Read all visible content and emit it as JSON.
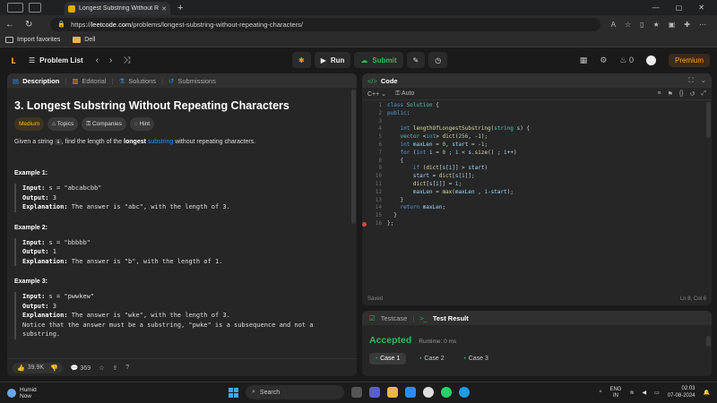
{
  "browser": {
    "tab_title": "Longest Substring Without Repea",
    "url_prefix": "https://",
    "url_host": "leetcode.com",
    "url_path": "/problems/longest-substring-without-repeating-characters/",
    "favorites": [
      "Import favorites",
      "Dell"
    ]
  },
  "nav": {
    "problem_list": "Problem List",
    "run": "Run",
    "submit": "Submit",
    "streak": "0",
    "premium": "Premium"
  },
  "left_tabs": [
    "Description",
    "Editorial",
    "Solutions",
    "Submissions"
  ],
  "problem": {
    "title": "3. Longest Substring Without Repeating Characters",
    "tags": [
      "Medium",
      "Topics",
      "Companies",
      "Hint"
    ],
    "statement_pre": "Given a string ",
    "statement_var": "s",
    "statement_mid": ", find the length of the ",
    "statement_bold": "longest",
    "statement_link": "substring",
    "statement_post": " without repeating characters.",
    "examples": [
      {
        "title": "Example 1:",
        "input": "s = \"abcabcbb\"",
        "output": "3",
        "explanation": "The answer is \"abc\", with the length of 3."
      },
      {
        "title": "Example 2:",
        "input": "s = \"bbbbb\"",
        "output": "1",
        "explanation": "The answer is \"b\", with the length of 1."
      },
      {
        "title": "Example 3:",
        "input": "s = \"pwwkew\"",
        "output": "3",
        "explanation": "The answer is \"wke\", with the length of 3.",
        "note1": "Notice that the answer must be a substring, \"pwke\" is a subsequence and not a",
        "note2": "substring."
      }
    ],
    "labels": {
      "input": "Input:",
      "output": "Output:",
      "explanation": "Explanation:"
    }
  },
  "left_footer": {
    "likes": "39.9K",
    "comments": "369"
  },
  "code": {
    "tab": "Code",
    "language": "C++",
    "mode": "Auto",
    "saved": "Saved",
    "cursor": "Ln 8, Col 6",
    "lines": [
      "class Solution {",
      "public:",
      "",
      "    int lengthOfLongestSubstring(string s) {",
      "    vector <int> dict(256, -1);",
      "    int maxLen = 0, start = -1;",
      "    for (int i = 0 ; i < s.size() ; i++)",
      "    {",
      "        if (dict[s[i]] > start)",
      "        start = dict[s[i]];",
      "        dict[s[i]] = i;",
      "        maxLen = max(maxLen , i-start);",
      "    }",
      "    return maxLen;",
      "  }",
      "};"
    ]
  },
  "test": {
    "tab1": "Testcase",
    "tab2": "Test Result",
    "status": "Accepted",
    "runtime": "Runtime: 0 ms",
    "cases": [
      "Case 1",
      "Case 2",
      "Case 3"
    ]
  },
  "taskbar": {
    "weather1": "Humid",
    "weather2": "Now",
    "search": "Search",
    "lang1": "ENG",
    "lang2": "IN",
    "time": "02:03",
    "date": "07-08-2024"
  }
}
